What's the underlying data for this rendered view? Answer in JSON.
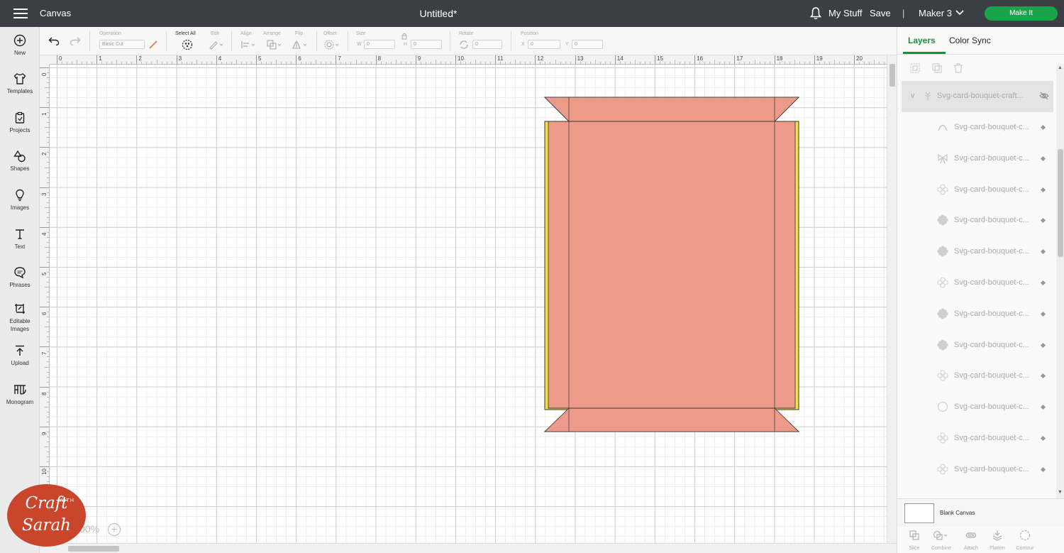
{
  "header": {
    "app_title": "Canvas",
    "doc_title": "Untitled*",
    "my_stuff": "My Stuff",
    "save": "Save",
    "separator": "|",
    "machine": "Maker 3",
    "make_it": "Make It"
  },
  "leftbar": {
    "items": [
      {
        "label": "New",
        "icon": "plus-circle-icon"
      },
      {
        "label": "Templates",
        "icon": "shirt-icon"
      },
      {
        "label": "Projects",
        "icon": "clipboard-icon"
      },
      {
        "label": "Shapes",
        "icon": "shapes-icon"
      },
      {
        "label": "Images",
        "icon": "bulb-icon"
      },
      {
        "label": "Text",
        "icon": "text-icon"
      },
      {
        "label": "Phrases",
        "icon": "speech-bubble-icon"
      },
      {
        "label": "Editable",
        "label2": "Images",
        "icon": "edit-image-icon"
      },
      {
        "label": "Upload",
        "icon": "upload-icon"
      },
      {
        "label": "Monogram",
        "icon": "monogram-icon"
      }
    ]
  },
  "toolbar": {
    "operation_label": "Operation",
    "operation_value": "Basic Cut",
    "select_all": "Select All",
    "edit": "Edit",
    "align": "Align",
    "arrange": "Arrange",
    "flip": "Flip",
    "offset": "Offset",
    "size": "Size",
    "w": "W",
    "w_value": "0",
    "h": "H",
    "h_value": "0",
    "rotate": "Rotate",
    "rotate_value": "0",
    "position": "Position",
    "x": "X",
    "x_value": "0",
    "y": "Y",
    "y_value": "0"
  },
  "ruler": {
    "top": [
      "0",
      "1",
      "2",
      "3",
      "4",
      "5",
      "6",
      "7",
      "8",
      "9",
      "10",
      "11",
      "12",
      "13",
      "14",
      "15",
      "16",
      "17",
      "18",
      "19",
      "20"
    ],
    "left": [
      "0",
      "1",
      "2",
      "3",
      "4",
      "5",
      "6",
      "7",
      "8",
      "9",
      "10"
    ]
  },
  "canvas": {
    "zoom_text": "00%",
    "zoom_plus": "+",
    "shape_fill": "#ec9a8a",
    "shape_outline": "#f2e04b"
  },
  "logo": {
    "line1": "Craft",
    "with": "WITH",
    "line2": "Sarah"
  },
  "panel": {
    "tab_layers": "Layers",
    "tab_color_sync": "Color Sync",
    "group_name": "Svg-card-bouquet-craft...",
    "layers": [
      {
        "name": "Svg-card-bouquet-c...",
        "icon": "arc-icon"
      },
      {
        "name": "Svg-card-bouquet-c...",
        "icon": "bow-icon"
      },
      {
        "name": "Svg-card-bouquet-c...",
        "icon": "flower-outline-icon"
      },
      {
        "name": "Svg-card-bouquet-c...",
        "icon": "flower-filled-icon"
      },
      {
        "name": "Svg-card-bouquet-c...",
        "icon": "flower-filled-icon"
      },
      {
        "name": "Svg-card-bouquet-c...",
        "icon": "flower-outline-icon"
      },
      {
        "name": "Svg-card-bouquet-c...",
        "icon": "flower-filled-icon"
      },
      {
        "name": "Svg-card-bouquet-c...",
        "icon": "flower-filled-icon"
      },
      {
        "name": "Svg-card-bouquet-c...",
        "icon": "flower-outline-icon"
      },
      {
        "name": "Svg-card-bouquet-c...",
        "icon": "circle-outline-icon"
      },
      {
        "name": "Svg-card-bouquet-c...",
        "icon": "flower-outline-icon"
      },
      {
        "name": "Svg-card-bouquet-c...",
        "icon": "flower-outline-icon"
      }
    ],
    "blank_canvas": "Blank Canvas",
    "bottom": [
      "Slice",
      "Combine",
      "Attach",
      "Flatten",
      "Contour"
    ]
  }
}
